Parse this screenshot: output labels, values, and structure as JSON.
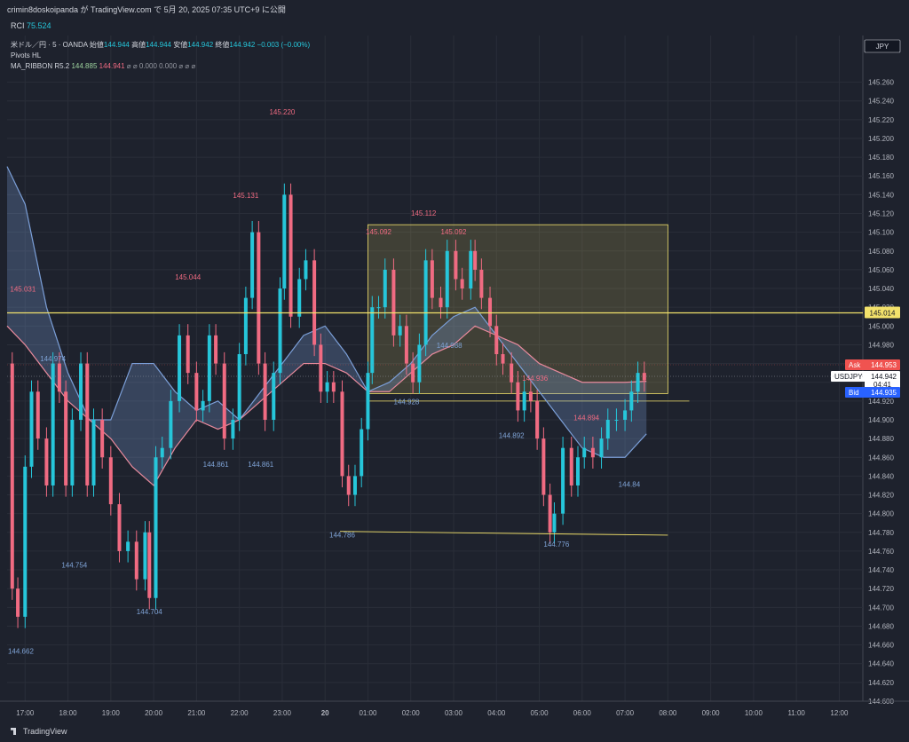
{
  "header": {
    "attribution": "crimin8doskoipanda が TradingView.com で 5月 20, 2025 07:35 UTC+9 に公開"
  },
  "rci": {
    "label": "RCI",
    "value": "75.524"
  },
  "legend": {
    "symbol": "米ドル／円 · 5 · OANDA",
    "open_label": "始値",
    "open": "144.944",
    "high_label": "高値",
    "high": "144.944",
    "low_label": "安値",
    "low": "144.942",
    "close_label": "終値",
    "close": "144.942",
    "change": "−0.003 (−0.00%)",
    "indicator1": "Pivots HL",
    "indicator2": "MA_RIBBON R5.2",
    "ma1": "144.885",
    "ma2": "144.941",
    "ma_rest": "⌀ ⌀ 0.000 0.000 ⌀ ⌀ ⌀"
  },
  "footer": {
    "brand": "TradingView"
  },
  "colors": {
    "bg": "#1e222d",
    "up": "#26c6da",
    "down": "#f06b82",
    "level": "#f3e26b",
    "ask": "#f05350",
    "bid": "#2962ff",
    "ribbon_blue": "#7b9fd8",
    "ribbon_pink": "#e88a9c"
  },
  "chart_data": {
    "type": "candlestick",
    "currency": "JPY",
    "ylim": [
      144.6,
      145.27
    ],
    "y_ticks": [
      "145.260",
      "145.240",
      "145.220",
      "145.200",
      "145.180",
      "145.160",
      "145.140",
      "145.120",
      "145.100",
      "145.080",
      "145.060",
      "145.040",
      "145.020",
      "145.000",
      "144.980",
      "144.960",
      "144.940",
      "144.920",
      "144.900",
      "144.880",
      "144.860",
      "144.840",
      "144.820",
      "144.800",
      "144.780",
      "144.760",
      "144.740",
      "144.720",
      "144.700",
      "144.680",
      "144.660",
      "144.640",
      "144.620",
      "144.600"
    ],
    "x_ticks": [
      "17:00",
      "18:00",
      "19:00",
      "20:00",
      "21:00",
      "22:00",
      "23:00",
      "20",
      "01:00",
      "02:00",
      "03:00",
      "04:00",
      "05:00",
      "06:00",
      "07:00",
      "08:00",
      "09:00",
      "10:00",
      "11:00",
      "12:00"
    ],
    "x_tick_hours": [
      17,
      18,
      19,
      20,
      21,
      22,
      23,
      24,
      25,
      26,
      27,
      28,
      29,
      30,
      31,
      32,
      33,
      34,
      35,
      36
    ],
    "x_range_hours": [
      16.58,
      36.55
    ],
    "close_series": [
      [
        16.6,
        144.96
      ],
      [
        16.7,
        144.72
      ],
      [
        16.83,
        144.69
      ],
      [
        17.0,
        144.85
      ],
      [
        17.15,
        144.93
      ],
      [
        17.3,
        144.88
      ],
      [
        17.5,
        144.83
      ],
      [
        17.65,
        144.96
      ],
      [
        17.8,
        144.93
      ],
      [
        17.95,
        144.83
      ],
      [
        18.1,
        144.9
      ],
      [
        18.3,
        144.96
      ],
      [
        18.45,
        144.83
      ],
      [
        18.6,
        144.9
      ],
      [
        18.8,
        144.86
      ],
      [
        19.0,
        144.81
      ],
      [
        19.2,
        144.76
      ],
      [
        19.4,
        144.77
      ],
      [
        19.6,
        144.73
      ],
      [
        19.8,
        144.78
      ],
      [
        19.9,
        144.71
      ],
      [
        20.05,
        144.86
      ],
      [
        20.2,
        144.87
      ],
      [
        20.4,
        144.92
      ],
      [
        20.6,
        144.99
      ],
      [
        20.8,
        144.95
      ],
      [
        21.0,
        144.91
      ],
      [
        21.15,
        144.92
      ],
      [
        21.3,
        144.99
      ],
      [
        21.45,
        144.96
      ],
      [
        21.65,
        144.88
      ],
      [
        21.85,
        144.9
      ],
      [
        22.0,
        144.97
      ],
      [
        22.15,
        145.03
      ],
      [
        22.3,
        145.1
      ],
      [
        22.45,
        144.96
      ],
      [
        22.6,
        144.9
      ],
      [
        22.8,
        144.95
      ],
      [
        22.95,
        145.04
      ],
      [
        23.05,
        145.14
      ],
      [
        23.2,
        145.01
      ],
      [
        23.4,
        145.05
      ],
      [
        23.55,
        145.07
      ],
      [
        23.75,
        144.98
      ],
      [
        23.9,
        144.93
      ],
      [
        24.05,
        144.94
      ],
      [
        24.2,
        144.93
      ],
      [
        24.4,
        144.84
      ],
      [
        24.55,
        144.82
      ],
      [
        24.7,
        144.84
      ],
      [
        24.85,
        144.89
      ],
      [
        25.0,
        144.95
      ],
      [
        25.1,
        145.02
      ],
      [
        25.25,
        145.02
      ],
      [
        25.4,
        145.06
      ],
      [
        25.6,
        144.99
      ],
      [
        25.75,
        145.0
      ],
      [
        25.9,
        144.96
      ],
      [
        26.05,
        144.94
      ],
      [
        26.2,
        144.98
      ],
      [
        26.35,
        145.07
      ],
      [
        26.5,
        145.03
      ],
      [
        26.7,
        145.02
      ],
      [
        26.85,
        145.08
      ],
      [
        27.05,
        145.05
      ],
      [
        27.2,
        145.04
      ],
      [
        27.4,
        145.08
      ],
      [
        27.5,
        145.06
      ],
      [
        27.65,
        145.03
      ],
      [
        27.85,
        145.0
      ],
      [
        28.0,
        144.97
      ],
      [
        28.15,
        144.96
      ],
      [
        28.35,
        144.94
      ],
      [
        28.5,
        144.91
      ],
      [
        28.65,
        144.93
      ],
      [
        28.8,
        144.92
      ],
      [
        28.95,
        144.88
      ],
      [
        29.1,
        144.82
      ],
      [
        29.25,
        144.78
      ],
      [
        29.35,
        144.8
      ],
      [
        29.55,
        144.87
      ],
      [
        29.75,
        144.83
      ],
      [
        29.9,
        144.86
      ],
      [
        30.05,
        144.87
      ],
      [
        30.25,
        144.86
      ],
      [
        30.45,
        144.88
      ],
      [
        30.6,
        144.9
      ],
      [
        30.8,
        144.9
      ],
      [
        31.0,
        144.91
      ],
      [
        31.15,
        144.93
      ],
      [
        31.3,
        144.95
      ],
      [
        31.45,
        144.942
      ]
    ],
    "pivot_labels": [
      {
        "x": 16.95,
        "y": 145.031,
        "text": "145.031",
        "kind": "high"
      },
      {
        "x": 17.65,
        "y": 144.974,
        "text": "144.974",
        "kind": "low"
      },
      {
        "x": 16.9,
        "y": 144.662,
        "text": "144.662",
        "kind": "low"
      },
      {
        "x": 18.15,
        "y": 144.754,
        "text": "144.754",
        "kind": "low"
      },
      {
        "x": 19.9,
        "y": 144.704,
        "text": "144.704",
        "kind": "low"
      },
      {
        "x": 20.8,
        "y": 145.044,
        "text": "145.044",
        "kind": "high"
      },
      {
        "x": 21.45,
        "y": 144.861,
        "text": "144.861",
        "kind": "low"
      },
      {
        "x": 22.5,
        "y": 144.861,
        "text": "144.861",
        "kind": "low"
      },
      {
        "x": 22.15,
        "y": 145.131,
        "text": "145.131",
        "kind": "high"
      },
      {
        "x": 23.0,
        "y": 145.22,
        "text": "145.220",
        "kind": "high"
      },
      {
        "x": 24.4,
        "y": 144.786,
        "text": "144.786",
        "kind": "low"
      },
      {
        "x": 25.25,
        "y": 145.092,
        "text": "145.092",
        "kind": "high"
      },
      {
        "x": 25.9,
        "y": 144.928,
        "text": "144.928",
        "kind": "low"
      },
      {
        "x": 26.3,
        "y": 145.112,
        "text": "145.112",
        "kind": "high"
      },
      {
        "x": 27.0,
        "y": 145.092,
        "text": "145.092",
        "kind": "high"
      },
      {
        "x": 26.9,
        "y": 144.988,
        "text": "144.988",
        "kind": "low"
      },
      {
        "x": 28.9,
        "y": 144.936,
        "text": "144.936",
        "kind": "high"
      },
      {
        "x": 28.35,
        "y": 144.892,
        "text": "144.892",
        "kind": "low"
      },
      {
        "x": 29.4,
        "y": 144.776,
        "text": "144.776",
        "kind": "low"
      },
      {
        "x": 30.1,
        "y": 144.894,
        "text": "144.894",
        "kind": "high"
      },
      {
        "x": 31.1,
        "y": 144.84,
        "text": "144.84",
        "kind": "low"
      }
    ],
    "levels": [
      {
        "price": 145.014,
        "label": "145.014",
        "kind": "horizontal"
      }
    ],
    "trend_line": {
      "x1": 24.35,
      "y1": 144.781,
      "x2": 32.0,
      "y2": 144.777
    },
    "box": {
      "x1": 25.0,
      "x2": 32.0,
      "y1": 144.928,
      "y2": 145.108
    },
    "box_baseline": {
      "x1": 25.0,
      "x2": 32.5,
      "y": 144.92
    },
    "price_tags": [
      {
        "label": "Ask",
        "value": "144.953",
        "kind": "ask"
      },
      {
        "label": "USDJPY",
        "value": "144.942",
        "kind": "last"
      },
      {
        "label": "",
        "value": "04:41",
        "kind": "countdown"
      },
      {
        "label": "Bid",
        "value": "144.935",
        "kind": "bid"
      }
    ],
    "ma_fast": [
      [
        16.58,
        145.17
      ],
      [
        17.0,
        145.13
      ],
      [
        17.5,
        145.02
      ],
      [
        18.0,
        144.95
      ],
      [
        18.5,
        144.9
      ],
      [
        19.0,
        144.9
      ],
      [
        19.5,
        144.96
      ],
      [
        20.0,
        144.96
      ],
      [
        20.5,
        144.93
      ],
      [
        21.0,
        144.91
      ],
      [
        21.5,
        144.92
      ],
      [
        22.0,
        144.9
      ],
      [
        22.5,
        144.93
      ],
      [
        23.0,
        144.96
      ],
      [
        23.5,
        144.99
      ],
      [
        24.0,
        145.0
      ],
      [
        24.5,
        144.97
      ],
      [
        25.0,
        144.93
      ],
      [
        25.5,
        144.94
      ],
      [
        26.0,
        144.96
      ],
      [
        26.5,
        144.99
      ],
      [
        27.0,
        145.01
      ],
      [
        27.5,
        145.02
      ],
      [
        28.0,
        144.99
      ],
      [
        28.5,
        144.96
      ],
      [
        29.0,
        144.93
      ],
      [
        29.5,
        144.9
      ],
      [
        30.0,
        144.87
      ],
      [
        30.5,
        144.86
      ],
      [
        31.0,
        144.86
      ],
      [
        31.5,
        144.885
      ]
    ],
    "ma_slow": [
      [
        16.58,
        145.0
      ],
      [
        17.0,
        144.98
      ],
      [
        17.5,
        144.95
      ],
      [
        18.0,
        144.92
      ],
      [
        18.5,
        144.9
      ],
      [
        19.0,
        144.88
      ],
      [
        19.5,
        144.85
      ],
      [
        20.0,
        144.83
      ],
      [
        20.5,
        144.87
      ],
      [
        21.0,
        144.9
      ],
      [
        21.5,
        144.89
      ],
      [
        22.0,
        144.9
      ],
      [
        22.5,
        144.92
      ],
      [
        23.0,
        144.94
      ],
      [
        23.5,
        144.96
      ],
      [
        24.0,
        144.96
      ],
      [
        24.5,
        144.95
      ],
      [
        25.0,
        144.93
      ],
      [
        25.5,
        144.93
      ],
      [
        26.0,
        144.95
      ],
      [
        26.5,
        144.97
      ],
      [
        27.0,
        144.98
      ],
      [
        27.5,
        145.0
      ],
      [
        28.0,
        144.99
      ],
      [
        28.5,
        144.98
      ],
      [
        29.0,
        144.96
      ],
      [
        29.5,
        144.95
      ],
      [
        30.0,
        144.94
      ],
      [
        30.5,
        144.94
      ],
      [
        31.0,
        144.94
      ],
      [
        31.5,
        144.941
      ]
    ]
  }
}
